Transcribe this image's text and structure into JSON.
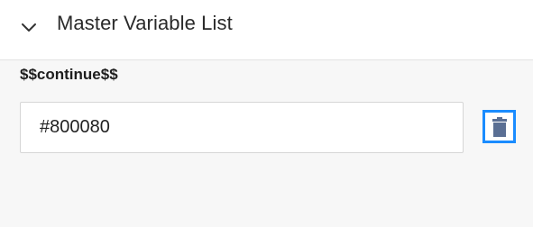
{
  "header": {
    "title": "Master Variable List",
    "chevron_icon": "chevron-down-icon"
  },
  "variable": {
    "label": "$$continue$$",
    "value": "#800080",
    "delete_icon": "trash-icon"
  },
  "colors": {
    "focus_ring": "#1a8cff",
    "trash_icon": "#5a6f94",
    "background": "#f7f7f7",
    "header_background": "#ffffff"
  }
}
